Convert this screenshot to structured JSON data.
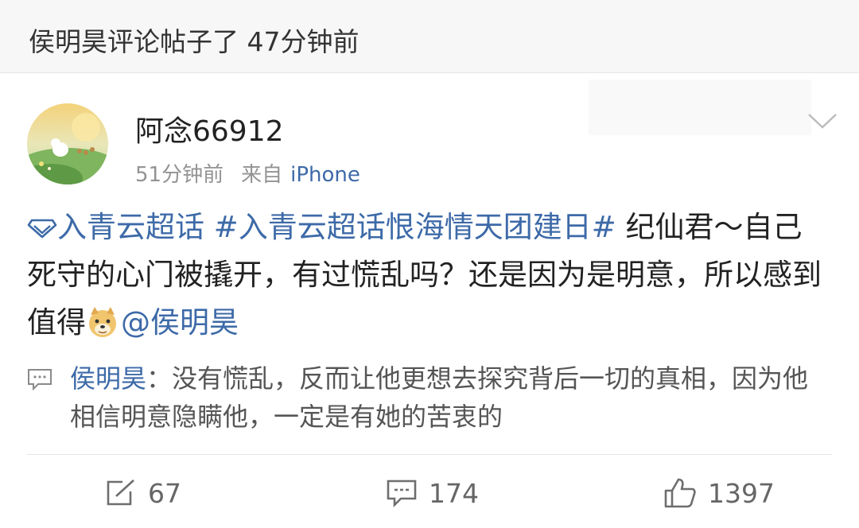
{
  "header": {
    "text": "侯明昊评论帖子了 47分钟前"
  },
  "post": {
    "username": "阿念66912",
    "time": "51分钟前",
    "source_prefix": "来自",
    "device": "iPhone",
    "topic1": "入青云超话",
    "topic2": "#入青云超话恨海情天团建日#",
    "text_part1": " 纪仙君～自己死守的心门被撬开，有过慌乱吗？还是因为是明意，所以感到值得",
    "mention": "@侯明昊"
  },
  "reply": {
    "name": "侯明昊",
    "colon": "：",
    "text": "没有慌乱，反而让他更想去探究背后一切的真相，因为他相信明意隐瞒他，一定是有她的苦衷的"
  },
  "actions": {
    "repost_count": "67",
    "comment_count": "174",
    "like_count": "1397"
  },
  "colors": {
    "link": "#3d6aa8",
    "meta": "#939393",
    "header_bg": "#f7f7f7"
  },
  "icons": [
    "diamond-icon",
    "doge-emoji-icon",
    "comment-bubble-icon",
    "repost-icon",
    "comment-icon",
    "like-icon",
    "chevron-down-icon"
  ]
}
